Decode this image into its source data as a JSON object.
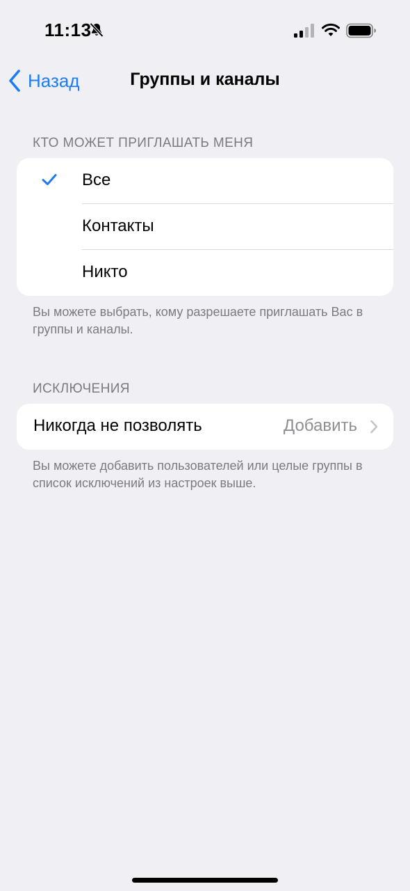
{
  "status_bar": {
    "time": "11:13",
    "icons": [
      "bell-slash-icon",
      "signal-icon",
      "wifi-icon",
      "battery-icon"
    ]
  },
  "nav": {
    "back_label": "Назад",
    "title": "Группы и каналы"
  },
  "invite_section": {
    "header": "КТО МОЖЕТ ПРИГЛАШАТЬ МЕНЯ",
    "options": [
      {
        "label": "Все",
        "selected": true
      },
      {
        "label": "Контакты",
        "selected": false
      },
      {
        "label": "Никто",
        "selected": false
      }
    ],
    "footer": "Вы можете выбрать, кому разрешаете приглашать Вас в группы и каналы."
  },
  "exceptions_section": {
    "header": "ИСКЛЮЧЕНИЯ",
    "row_label": "Никогда не позволять",
    "row_value": "Добавить",
    "footer": "Вы можете добавить пользователей или целые группы в список исключений из настроек выше."
  },
  "colors": {
    "accent": "#1C7CF4",
    "background": "#EFEFF4",
    "card": "#FFFFFF",
    "secondary_text": "#7A7A80"
  }
}
